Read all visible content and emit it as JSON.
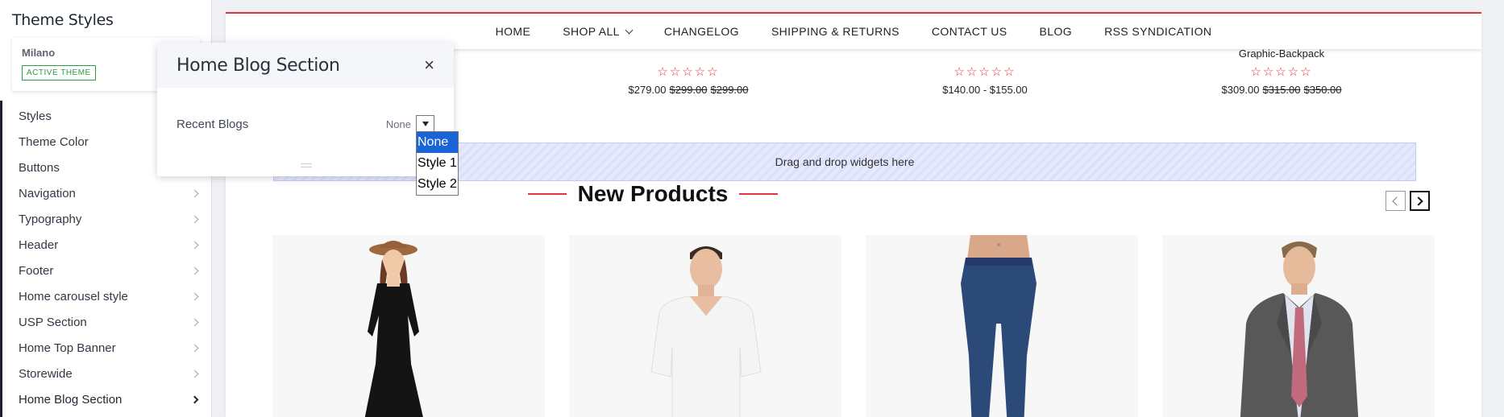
{
  "sidebar": {
    "title": "Theme Styles",
    "theme": {
      "name": "Milano",
      "badge": "ACTIVE THEME"
    },
    "items": [
      {
        "label": "Styles",
        "chevron": false
      },
      {
        "label": "Theme Color",
        "chevron": false
      },
      {
        "label": "Buttons",
        "chevron": false
      },
      {
        "label": "Navigation",
        "chevron": true
      },
      {
        "label": "Typography",
        "chevron": true
      },
      {
        "label": "Header",
        "chevron": true
      },
      {
        "label": "Footer",
        "chevron": true
      },
      {
        "label": "Home carousel style",
        "chevron": true
      },
      {
        "label": "USP Section",
        "chevron": true
      },
      {
        "label": "Home Top Banner",
        "chevron": true
      },
      {
        "label": "Storewide",
        "chevron": true
      },
      {
        "label": "Home Blog Section",
        "chevron": true,
        "active": true
      }
    ]
  },
  "nav": {
    "items": [
      "HOME",
      "SHOP ALL",
      "CHANGELOG",
      "SHIPPING & RETURNS",
      "CONTACT US",
      "BLOG",
      "RSS SYNDICATION"
    ]
  },
  "products_top": [
    {
      "name": "",
      "stars": "☆☆☆☆☆",
      "price": "$279.00",
      "old1": "$299.00",
      "old2": "$299.00"
    },
    {
      "name": "",
      "stars": "☆☆☆☆☆",
      "price": "$140.00 - $155.00",
      "old1": "",
      "old2": ""
    },
    {
      "name": "Graphic-Backpack",
      "stars": "☆☆☆☆☆",
      "price": "$309.00",
      "old1": "$315.00",
      "old2": "$350.00"
    }
  ],
  "dropzone": {
    "text": "Drag and drop widgets here"
  },
  "section": {
    "title": "New Products"
  },
  "panel": {
    "title": "Home Blog Section",
    "close_icon": "×",
    "field_label": "Recent Blogs",
    "field_value": "None",
    "options": [
      "None",
      "Style 1",
      "Style 2"
    ],
    "selected_index": 0
  },
  "colors": {
    "accent": "#e3333f",
    "selection": "#1a64d8",
    "badge": "#2a9d43"
  }
}
